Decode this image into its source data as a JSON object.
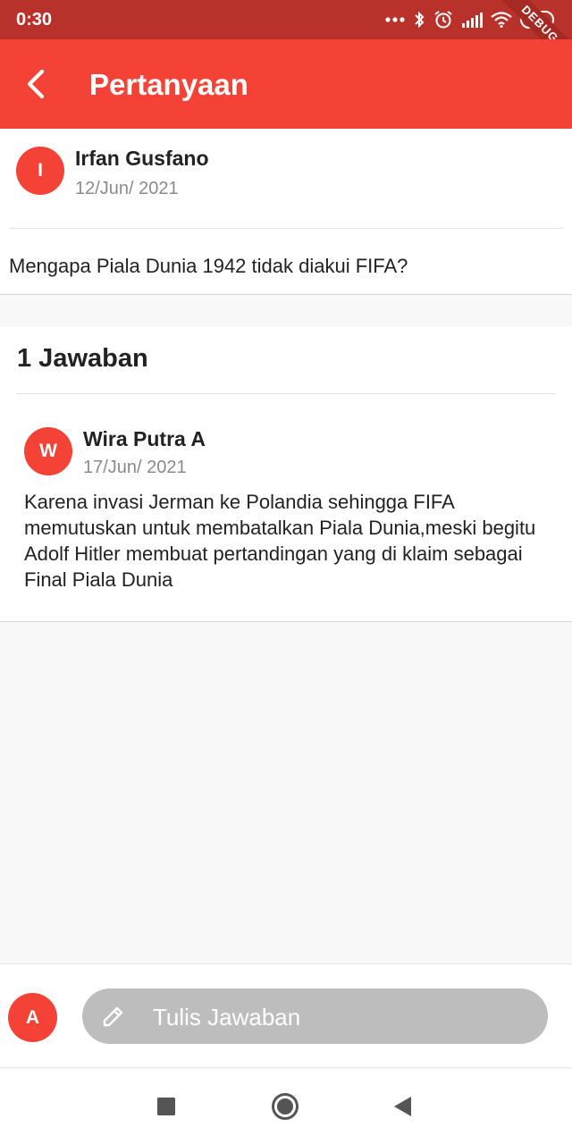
{
  "status_bar": {
    "time": "0:30",
    "battery": "84",
    "icons": [
      "more-dots-icon",
      "bluetooth-icon",
      "alarm-icon",
      "signal-icon",
      "wifi-icon",
      "battery-icon"
    ]
  },
  "debug_banner": "DEBUG",
  "app_bar": {
    "title": "Pertanyaan",
    "back_icon": "chevron-left-icon",
    "background": "#f44336"
  },
  "question": {
    "author_initial": "I",
    "author": "Irfan Gusfano",
    "date": "12/Jun/ 2021",
    "text": "Mengapa Piala Dunia 1942 tidak diakui FIFA?"
  },
  "answers": {
    "heading": "1 Jawaban",
    "items": [
      {
        "author_initial": "W",
        "author": "Wira Putra A",
        "date": "17/Jun/ 2021",
        "text": "Karena invasi Jerman ke Polandia sehingga FIFA memutuskan untuk membatalkan Piala Dunia,meski begitu Adolf Hitler membuat pertandingan yang di klaim sebagai Final Piala Dunia"
      }
    ]
  },
  "compose": {
    "user_initial": "A",
    "placeholder": "Tulis Jawaban",
    "icon": "pencil-icon"
  },
  "nav_bar": {
    "buttons": [
      "recent-apps-icon",
      "home-icon",
      "back-triangle-icon"
    ]
  }
}
